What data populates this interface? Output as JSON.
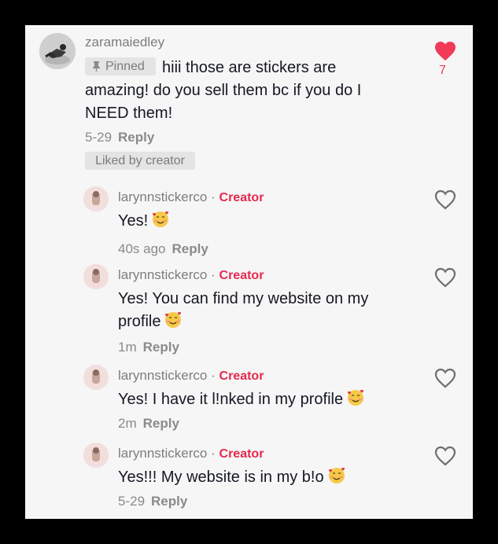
{
  "main_comment": {
    "username": "zaramaiedley",
    "pinned_label": "Pinned",
    "text": "hiii those are stickers are amazing! do you sell them bc if you do I NEED them!",
    "time": "5-29",
    "reply_label": "Reply",
    "liked_by_creator": "Liked by creator",
    "like_count": "7",
    "like_icon": "heart-filled-icon",
    "accent_color": "#f03a57"
  },
  "replies": [
    {
      "username": "larynnstickerco",
      "badge": "Creator",
      "text": "Yes!",
      "time": "40s ago",
      "reply_label": "Reply"
    },
    {
      "username": "larynnstickerco",
      "badge": "Creator",
      "text_line1": "Yes! You can find my website on my",
      "text_line2": "profile",
      "time": "1m",
      "reply_label": "Reply"
    },
    {
      "username": "larynnstickerco",
      "badge": "Creator",
      "text": "Yes! I have it l!nked in my profile",
      "time": "2m",
      "reply_label": "Reply"
    },
    {
      "username": "larynnstickerco",
      "badge": "Creator",
      "text": "Yes!!! My website is in my b!o",
      "time": "5-29",
      "reply_label": "Reply"
    }
  ],
  "separator": "·",
  "emoji_icon": "smiling-face-with-hearts-icon",
  "creator_color": "#e5294f"
}
